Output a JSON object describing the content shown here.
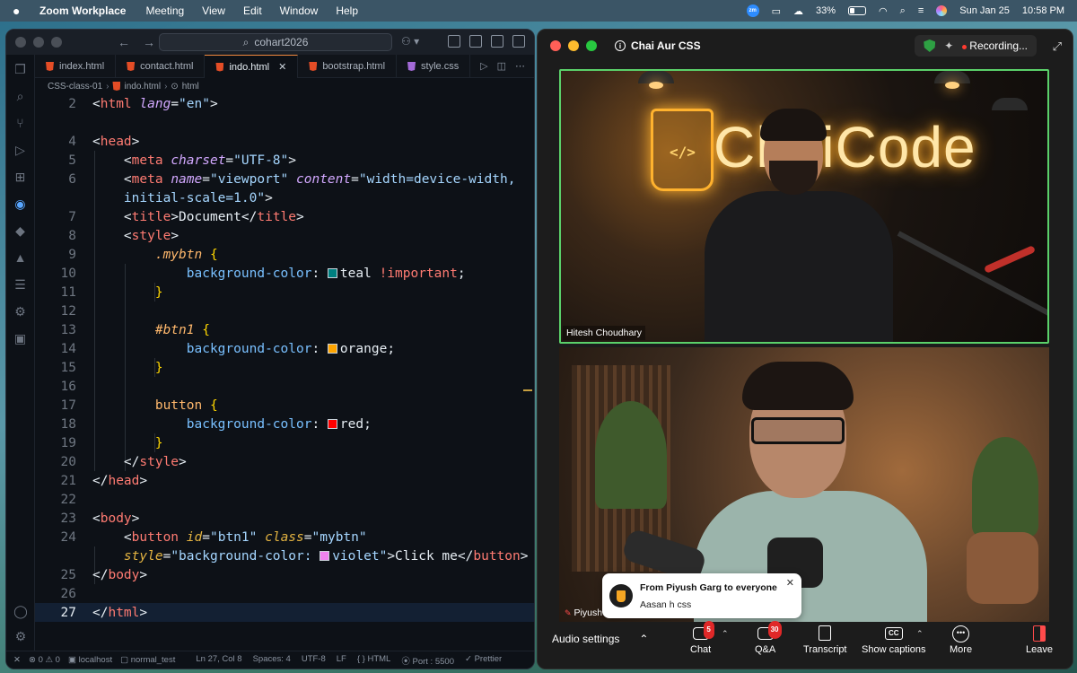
{
  "menubar": {
    "app_name": "Zoom Workplace",
    "items": [
      "Meeting",
      "View",
      "Edit",
      "Window",
      "Help"
    ],
    "zm_badge": "zm",
    "battery_percent": "33%",
    "battery_level": 0.33,
    "date": "Sun Jan 25",
    "time": "10:58 PM"
  },
  "vscode": {
    "search_text": "cohart2026",
    "tabs": [
      {
        "label": "index.html",
        "type": "html"
      },
      {
        "label": "contact.html",
        "type": "html"
      },
      {
        "label": "indo.html",
        "type": "html",
        "active": true
      },
      {
        "label": "bootstrap.html",
        "type": "html"
      },
      {
        "label": "style.css",
        "type": "css"
      }
    ],
    "breadcrumb": [
      "CSS-class-01",
      "indo.html",
      "html"
    ],
    "line_numbers": [
      "2",
      "",
      "4",
      "5",
      "6",
      "",
      "7",
      "8",
      "9",
      "10",
      "11",
      "12",
      "13",
      "14",
      "15",
      "16",
      "17",
      "18",
      "19",
      "20",
      "21",
      "22",
      "23",
      "24",
      "",
      "25",
      "26",
      "27"
    ],
    "code": {
      "html_tag": "html",
      "lang_attr": "lang",
      "lang_val": "\"en\"",
      "head_tag": "head",
      "meta_tag": "meta",
      "charset_attr": "charset",
      "charset_val": "\"UTF-8\"",
      "name_attr": "name",
      "name_val": "\"viewport\"",
      "content_attr": "content",
      "content_val_1": "\"width=device-width,",
      "content_val_2": "initial-scale=1.0\"",
      "title_tag": "title",
      "title_text": "Document",
      "style_tag": "style",
      "sel1": ".mybtn",
      "prop": "background-color",
      "teal": "teal",
      "important": "!important",
      "sel2": "#btn1",
      "orange": "orange",
      "sel3": "button",
      "red": "red",
      "body_tag": "body",
      "button_tag": "button",
      "id_attr": "id",
      "id_val": "\"btn1\"",
      "class_attr": "class",
      "class_val": "\"mybtn\"",
      "style_attr": "style",
      "style_val_a": "\"background-color: ",
      "violet": "violet",
      "style_val_b": "\"",
      "button_text": "Click me"
    },
    "status": {
      "errors": "0",
      "warnings": "0",
      "host": "localhost",
      "profile": "normal_test",
      "position": "Ln 27, Col 8",
      "spaces": "Spaces: 4",
      "encoding": "UTF-8",
      "eol": "LF",
      "language": "HTML",
      "port": "Port : 5500",
      "formatter": "Prettier"
    }
  },
  "zoom": {
    "meeting_title": "Chai Aur CSS",
    "recording_label": "Recording...",
    "neon_sign": "ChaiCode",
    "neon_cup_text": "</>",
    "participant1": "Hitesh Choudhary",
    "participant2": "Piyush",
    "toast": {
      "title": "From Piyush Garg to everyone",
      "message": "Aasan h css"
    },
    "toolbar": {
      "audio_settings": "Audio settings",
      "chat": "Chat",
      "chat_badge": "5",
      "qa": "Q&A",
      "qa_badge": "30",
      "transcript": "Transcript",
      "captions": "Show captions",
      "cc": "CC",
      "more": "More",
      "leave": "Leave"
    }
  },
  "colors": {
    "teal": "#008080",
    "orange": "#ffa500",
    "red": "#ff0000",
    "violet": "#ee82ee",
    "active_speaker": "#5bd16a",
    "accent_blue": "#58a6ff"
  }
}
